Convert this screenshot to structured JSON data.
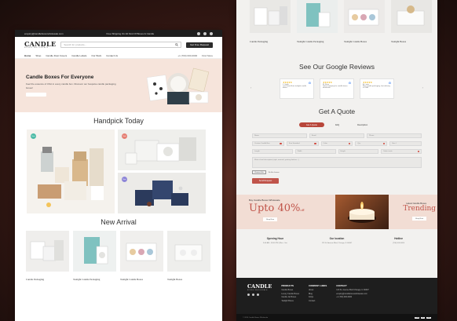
{
  "left": {
    "topbar": {
      "email": "enquiry@candleboxeswholesale.com",
      "shipping": "Free Shipping On All Kind Of Boxes & Candle"
    },
    "header": {
      "logo_main": "CANDLE",
      "logo_sub": "BOXES WHOLESALE",
      "search_placeholder": "Search for products...",
      "quote_button": "Get Free Request"
    },
    "nav": {
      "items": [
        "Home",
        "Shop",
        "Candle Dust Covers",
        "Candle Labels",
        "Our Work",
        "Contact Us"
      ],
      "phone": "+1 (700) 000-0000",
      "find_store": "Find Store"
    },
    "hero": {
      "title": "Candle Boxes For Everyone",
      "text": "Feel the essence of USA in every candle box. Discover our bespoke candle packaging boxes!",
      "button": ""
    },
    "handpick": {
      "title": "Handpick Today",
      "badges": [
        "New",
        "Sale",
        "New"
      ]
    },
    "new_arrival": {
      "title": "New Arrival",
      "items": [
        "Candle Packaging",
        "Tealight Candle Packaging",
        "Tealight Candle Boxes",
        "Tealight Boxes"
      ]
    }
  },
  "right": {
    "top_products": [
      "Candle Packaging",
      "Tealight Candle Packaging",
      "Tealight Candle Boxes",
      "Tealight Boxes"
    ],
    "reviews": {
      "title": "See Our Google Reviews",
      "cards": [
        {
          "name": "J. Smith",
          "stars": "★★★★★",
          "text": "I just loved their tealight candle boxes"
        },
        {
          "name": "M. Rose",
          "stars": "★★★★★",
          "text": "Great company for candle boxes wholesale"
        },
        {
          "name": "A. Lewis",
          "stars": "★★★★★",
          "text": "Best candle packaging, fast delivery in USA"
        }
      ]
    },
    "quote": {
      "title": "Get A Quote",
      "tabs": [
        "Get A Quote",
        "FAQ",
        "Description"
      ],
      "fields": {
        "name": "Name",
        "email": "Email",
        "phone": "Phone",
        "box_type": "Custom Candle Box",
        "size": "Size Standard",
        "color": "Color",
        "qty": "Qty",
        "size2": "Size #",
        "length": "Length",
        "width": "Width",
        "height": "Height",
        "select_units": "Select units",
        "message": "Write a brief description (style, material, printing finishes...)"
      },
      "file_button": "Choose File",
      "file_status": "No file chosen",
      "submit": "Send Request"
    },
    "banner": {
      "pre": "Buy Candle Boxes Wholesale",
      "upto": "Upto 40%",
      "off": "off",
      "shop_now": "Shop Now",
      "right_pre": "Latest Candle Boxes",
      "trending": "Trending",
      "shop_now2": "Shop Now"
    },
    "info": [
      {
        "title": "Opening Hour",
        "text": "9:00 AM - 09:00 PM | Mon - Sat"
      },
      {
        "title": "Our location",
        "text": "123 St. Avenue Blvd, Chicago, IL 60607"
      },
      {
        "title": "Hotline",
        "text": "(700) 000-0000"
      }
    ],
    "footer": {
      "logo_main": "CANDLE",
      "logo_sub": "BOXES WHOLESALE",
      "products_title": "PRODUCTS",
      "products": [
        "Candle Boxes",
        "Luxury Candle Boxes",
        "Candle Jar Boxes",
        "Tealight Boxes"
      ],
      "company_title": "COMPANY LINKS",
      "company": [
        "About",
        "Blog",
        "FAQs",
        "Contact"
      ],
      "contact_title": "CONTACT",
      "contact": [
        "123 St. Avenue Blvd Chicago, IL 60607",
        "enquiry@candleboxeswholesale.com",
        "+1 (700) 000-0000"
      ],
      "copyright": "© 2024 Candle Boxes Wholesale",
      "pay": [
        "VISA",
        "MC",
        "PAY"
      ]
    }
  },
  "colors": {
    "accent": "#c0544a",
    "hero_bg": "#f6e4db",
    "dark": "#1e1e1e"
  }
}
